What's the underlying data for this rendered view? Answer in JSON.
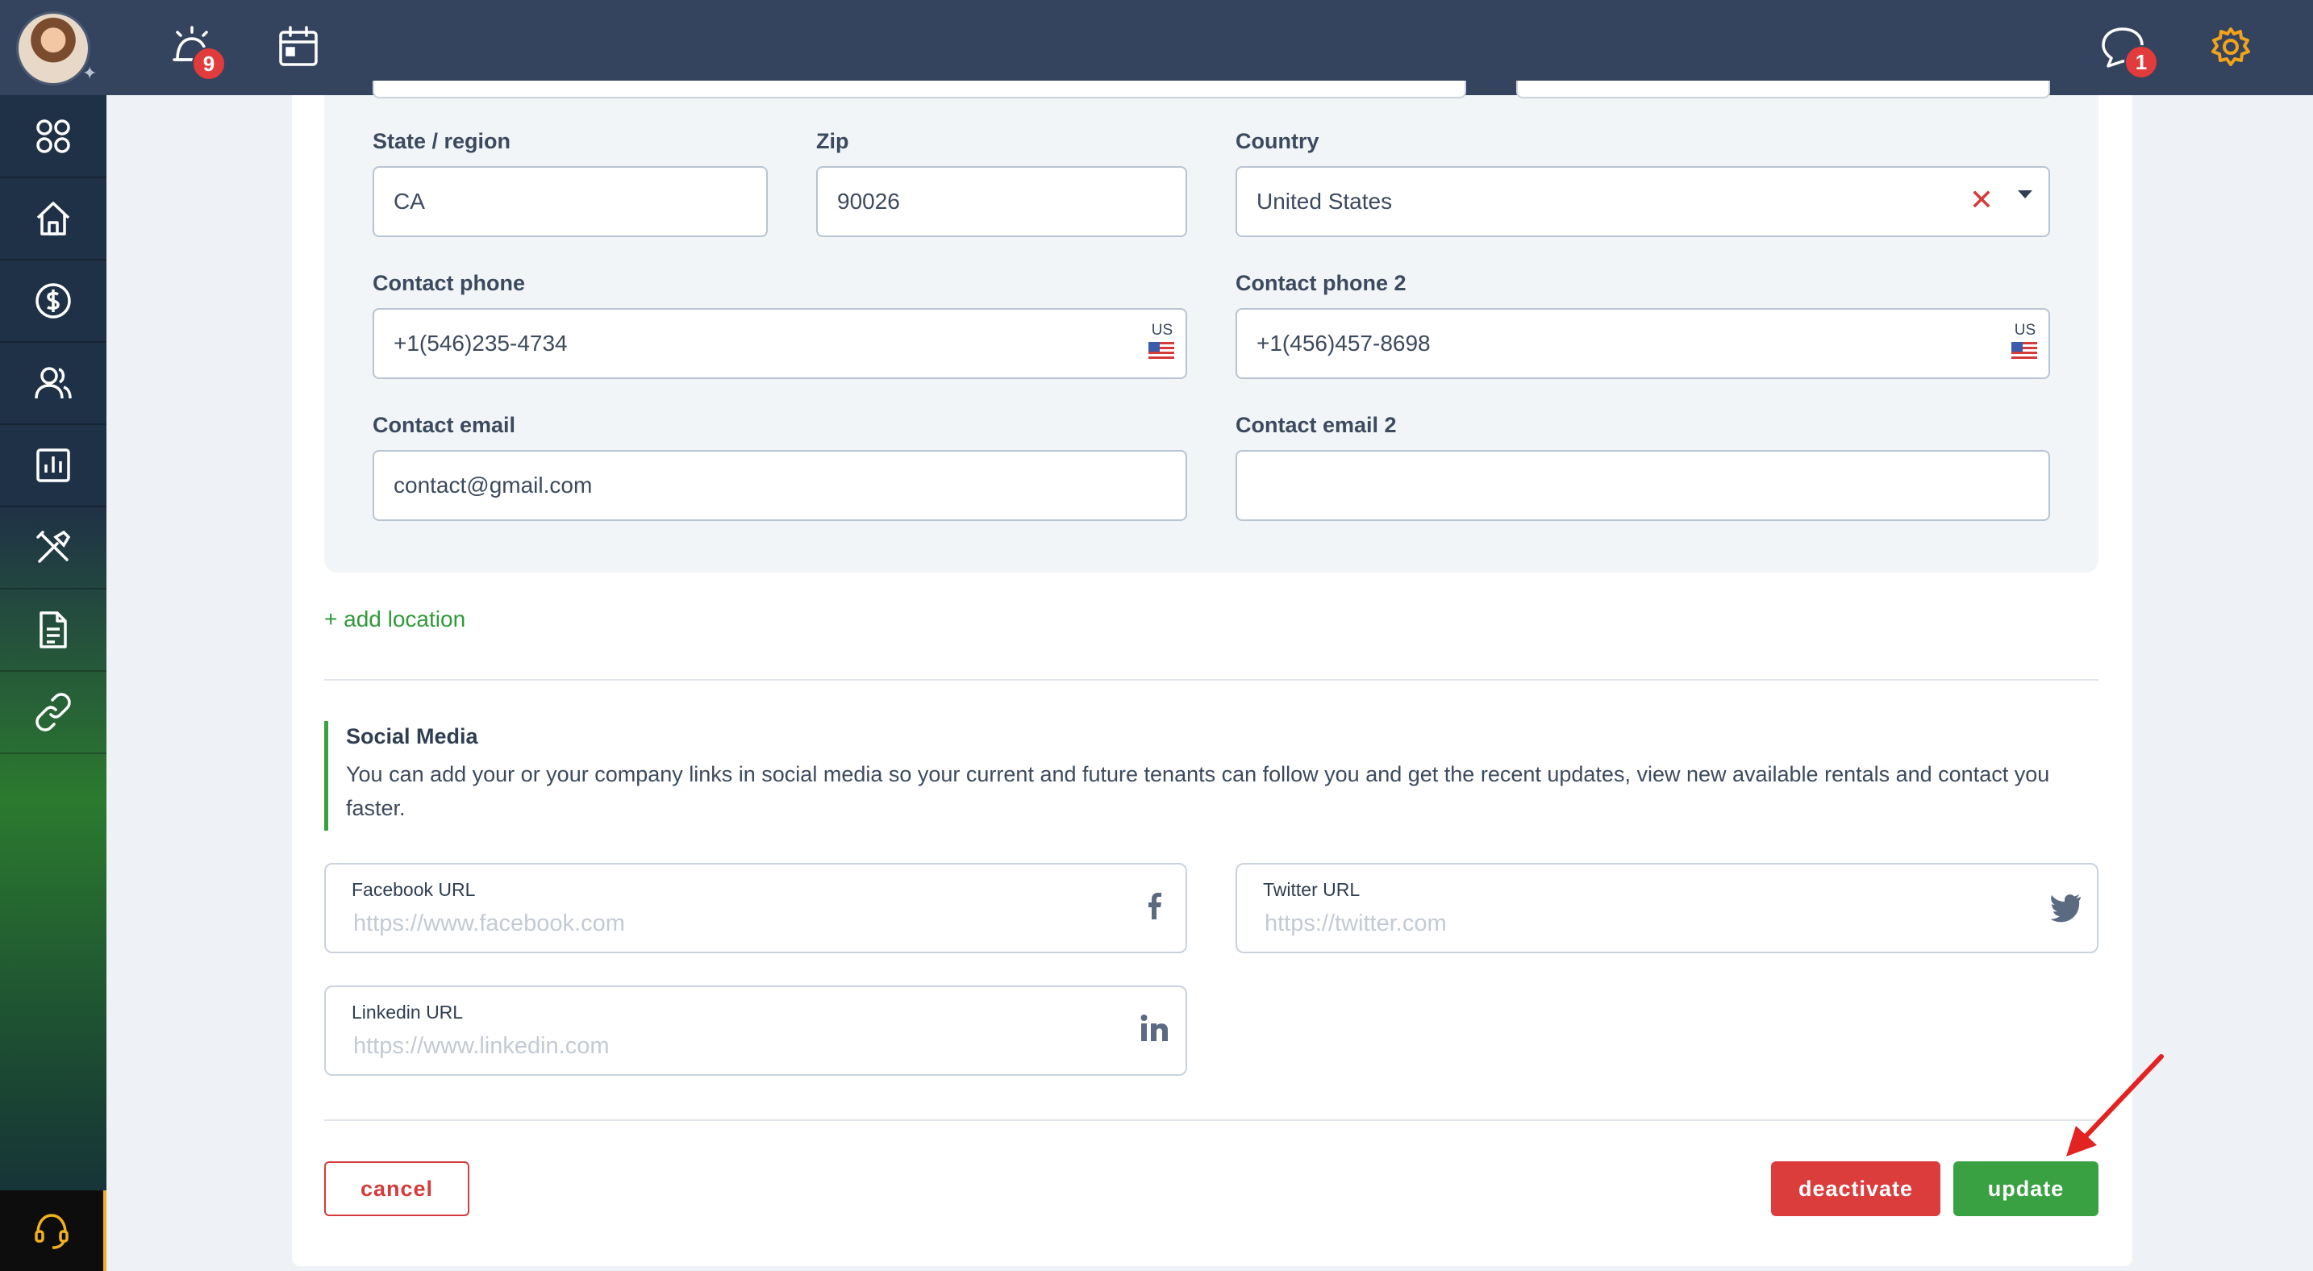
{
  "topbar": {
    "alarm_badge": "9",
    "chat_badge": "1",
    "icons": [
      "avatar",
      "pin-icon",
      "alarm-clock-icon",
      "calendar-icon",
      "chat-bubble-icon",
      "gear-icon"
    ]
  },
  "sidebar": {
    "items": [
      "dashboard-icon",
      "home-icon",
      "dollar-icon",
      "users-icon",
      "report-chart-icon",
      "tools-icon",
      "document-icon",
      "link-icon"
    ],
    "support_icon": "headset-icon"
  },
  "location": {
    "state_label": "State / region",
    "state_value": "CA",
    "zip_label": "Zip",
    "zip_value": "90026",
    "country_label": "Country",
    "country_value": "United States",
    "phone_label": "Contact phone",
    "phone_value": "+1(546)235-4734",
    "phone_country": "US",
    "phone2_label": "Contact phone 2",
    "phone2_value": "+1(456)457-8698",
    "phone2_country": "US",
    "email_label": "Contact email",
    "email_value": "contact@gmail.com",
    "email2_label": "Contact email 2",
    "email2_value": ""
  },
  "add_location": "+ add location",
  "social": {
    "title": "Social Media",
    "description": "You can add your or your company links in social media so your current and future tenants can follow you and get the recent updates, view new available rentals and contact you faster.",
    "facebook_label": "Facebook URL",
    "facebook_placeholder": "https://www.facebook.com",
    "twitter_label": "Twitter URL",
    "twitter_placeholder": "https://twitter.com",
    "linkedin_label": "Linkedin URL",
    "linkedin_placeholder": "https://www.linkedin.com"
  },
  "actions": {
    "cancel": "cancel",
    "deactivate": "deactivate",
    "update": "update"
  },
  "colors": {
    "topbar": "#34445e",
    "accent_green": "#3aa143",
    "danger_red": "#db3d3d",
    "gear_orange": "#f2a31b",
    "annotation_arrow": "#e32222"
  }
}
